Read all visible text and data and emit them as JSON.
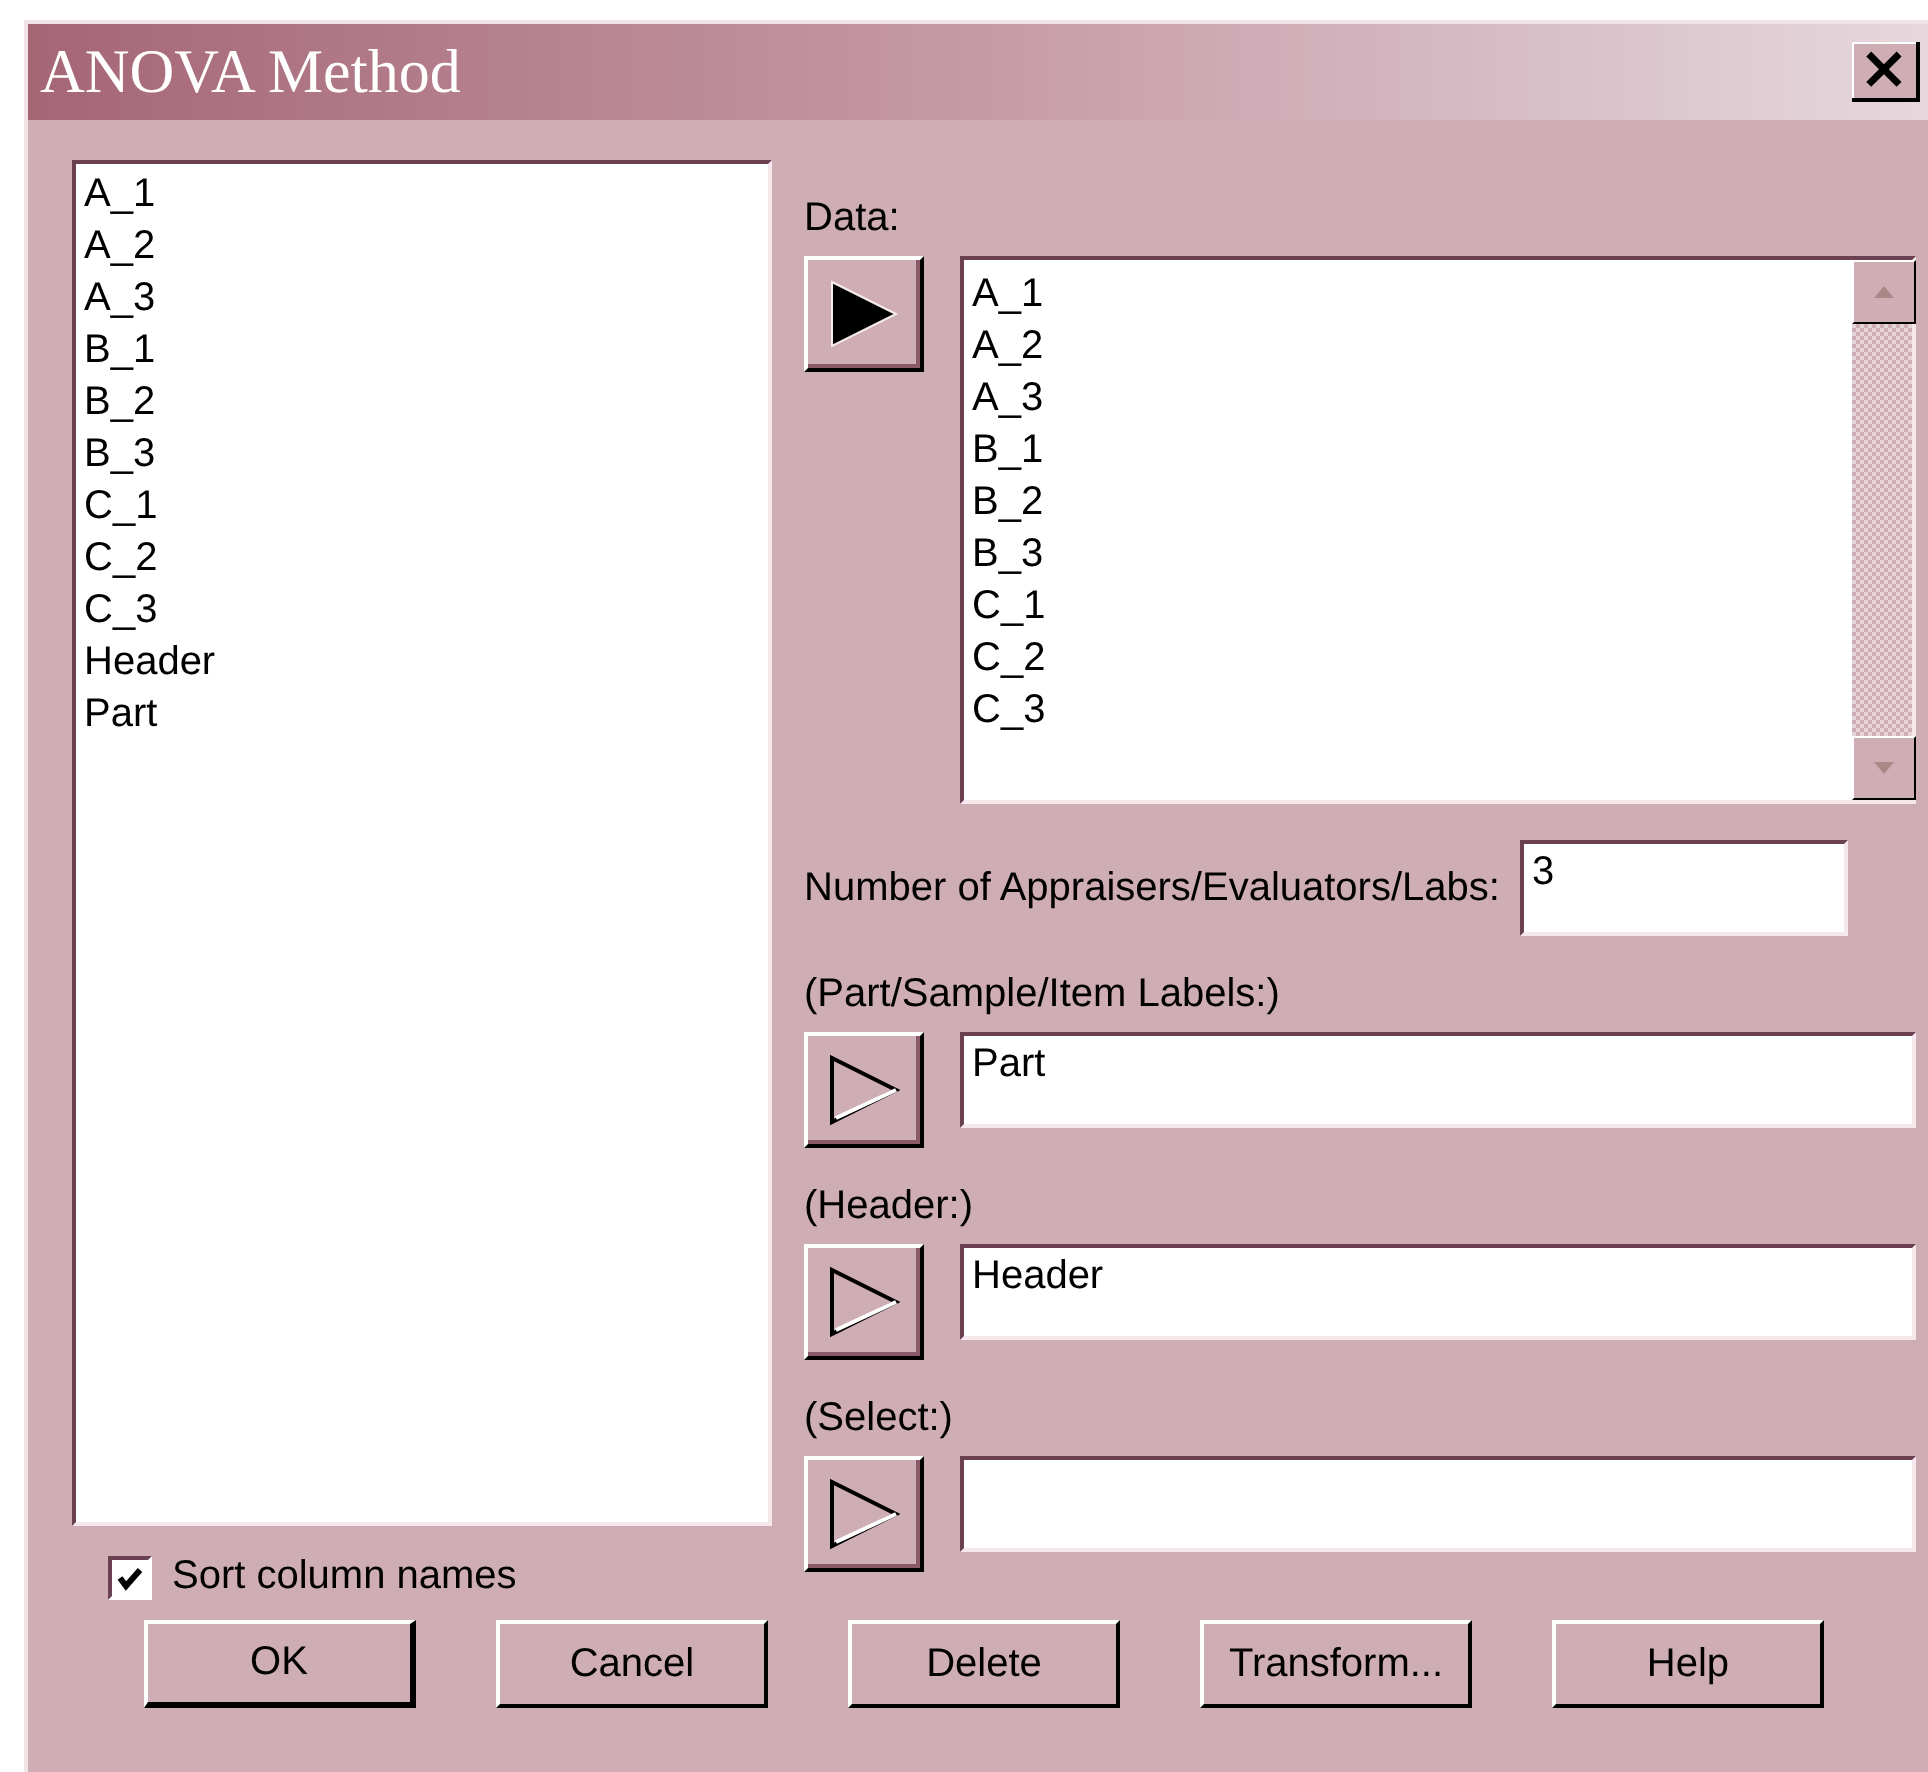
{
  "window": {
    "title": "ANOVA Method",
    "close": "×"
  },
  "columns": [
    "A_1",
    "A_2",
    "A_3",
    "B_1",
    "B_2",
    "B_3",
    "C_1",
    "C_2",
    "C_3",
    "Header",
    "Part"
  ],
  "data": {
    "label": "Data:",
    "arrow_active": true,
    "items": [
      "A_1",
      "A_2",
      "A_3",
      "B_1",
      "B_2",
      "B_3",
      "C_1",
      "C_2",
      "C_3"
    ]
  },
  "appraisers": {
    "label": "Number of Appraisers/Evaluators/Labs:",
    "value": "3"
  },
  "fields": [
    {
      "label": "(Part/Sample/Item Labels:)",
      "arrow_active": false,
      "value": "Part"
    },
    {
      "label": "(Header:)",
      "arrow_active": false,
      "value": "Header"
    },
    {
      "label": "(Select:)",
      "arrow_active": false
    }
  ],
  "sort": {
    "label": "Sort column names",
    "checked": true
  },
  "buttons": [
    "OK",
    "Cancel",
    "Delete",
    "Transform...",
    "Help"
  ]
}
